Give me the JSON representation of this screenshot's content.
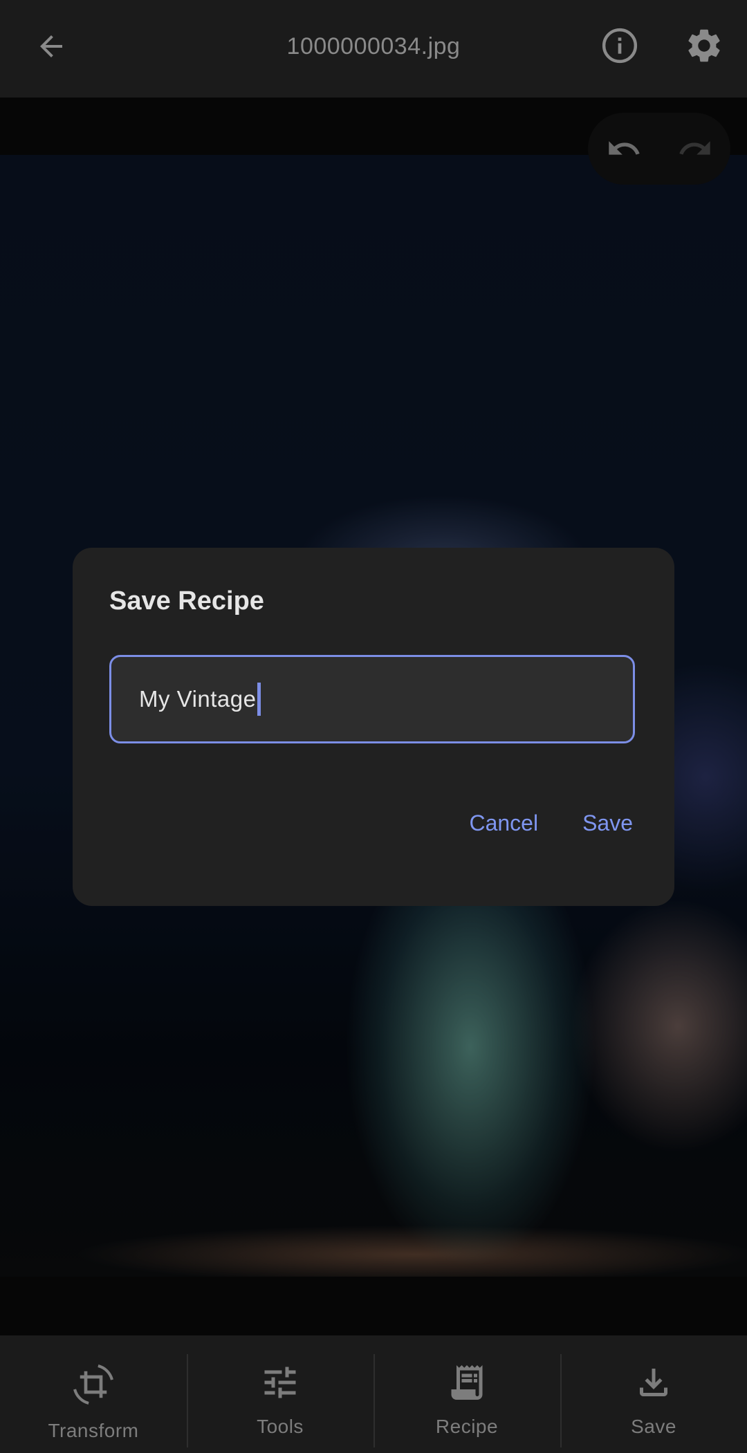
{
  "topbar": {
    "title": "1000000034.jpg",
    "back_icon": "arrow-back-icon",
    "info_icon": "info-icon",
    "settings_icon": "gear-icon"
  },
  "history": {
    "undo_icon": "undo-icon",
    "redo_icon": "redo-icon"
  },
  "dialog": {
    "title": "Save Recipe",
    "input_value": "My Vintage",
    "cancel_label": "Cancel",
    "save_label": "Save",
    "accent_color": "#7f96f0"
  },
  "bottom_nav": {
    "items": [
      {
        "label": "Transform",
        "icon": "crop-rotate-icon"
      },
      {
        "label": "Tools",
        "icon": "tune-sliders-icon"
      },
      {
        "label": "Recipe",
        "icon": "receipt-icon"
      },
      {
        "label": "Save",
        "icon": "download-icon"
      }
    ]
  }
}
